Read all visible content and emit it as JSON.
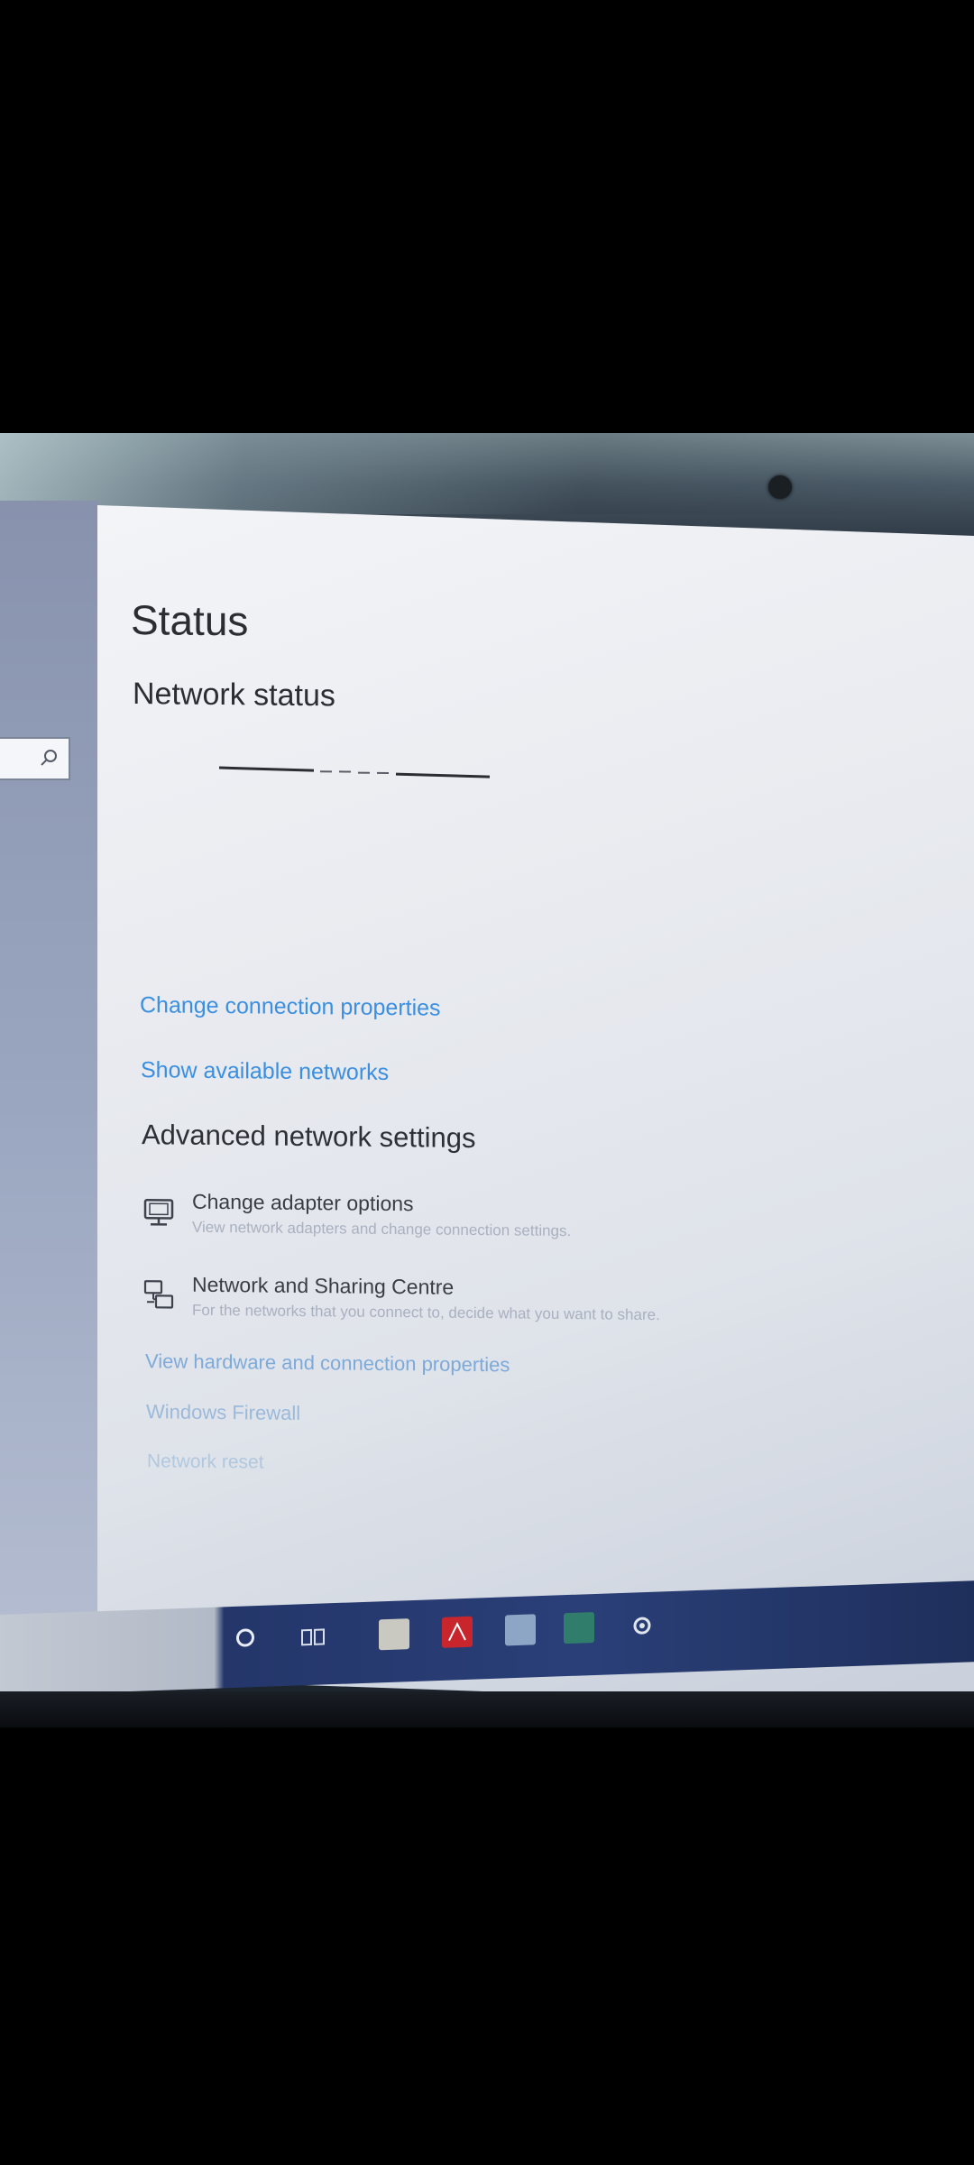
{
  "window": {
    "page_title": "Status",
    "section_title": "Network status"
  },
  "links": {
    "change_connection_properties": "Change connection properties",
    "show_available_networks": "Show available networks",
    "view_hardware": "View hardware and connection properties",
    "windows_firewall": "Windows Firewall",
    "network_reset": "Network reset"
  },
  "advanced": {
    "title": "Advanced network settings",
    "items": [
      {
        "title": "Change adapter options",
        "description": "View network adapters and change connection settings.",
        "icon": "monitor-icon"
      },
      {
        "title": "Network and Sharing Centre",
        "description": "For the networks that you connect to, decide what you want to share.",
        "icon": "sharing-icon"
      }
    ]
  },
  "colors": {
    "link": "#3b8fe0",
    "title_text": "#2b2d33",
    "taskbar": "#2a3f78"
  },
  "taskbar": {
    "icons": [
      "cortana-icon",
      "task-view-icon",
      "store-icon",
      "acrobat-icon",
      "file-explorer-icon",
      "excel-icon",
      "settings-gear-icon"
    ]
  }
}
